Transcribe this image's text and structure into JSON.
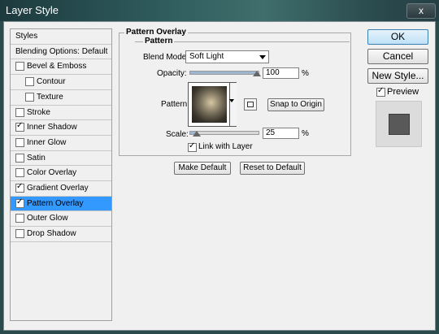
{
  "window": {
    "title": "Layer Style",
    "close_glyph": "x"
  },
  "styles_list": [
    {
      "label": "Styles",
      "checkbox": false,
      "checked": false,
      "indent": 0,
      "selected": false
    },
    {
      "label": "Blending Options: Default",
      "checkbox": false,
      "checked": false,
      "indent": 0,
      "selected": false
    },
    {
      "label": "Bevel & Emboss",
      "checkbox": true,
      "checked": false,
      "indent": 0,
      "selected": false
    },
    {
      "label": "Contour",
      "checkbox": true,
      "checked": false,
      "indent": 1,
      "selected": false
    },
    {
      "label": "Texture",
      "checkbox": true,
      "checked": false,
      "indent": 1,
      "selected": false
    },
    {
      "label": "Stroke",
      "checkbox": true,
      "checked": false,
      "indent": 0,
      "selected": false
    },
    {
      "label": "Inner Shadow",
      "checkbox": true,
      "checked": true,
      "indent": 0,
      "selected": false
    },
    {
      "label": "Inner Glow",
      "checkbox": true,
      "checked": false,
      "indent": 0,
      "selected": false
    },
    {
      "label": "Satin",
      "checkbox": true,
      "checked": false,
      "indent": 0,
      "selected": false
    },
    {
      "label": "Color Overlay",
      "checkbox": true,
      "checked": false,
      "indent": 0,
      "selected": false
    },
    {
      "label": "Gradient Overlay",
      "checkbox": true,
      "checked": true,
      "indent": 0,
      "selected": false
    },
    {
      "label": "Pattern Overlay",
      "checkbox": true,
      "checked": true,
      "indent": 0,
      "selected": true
    },
    {
      "label": "Outer Glow",
      "checkbox": true,
      "checked": false,
      "indent": 0,
      "selected": false
    },
    {
      "label": "Drop Shadow",
      "checkbox": true,
      "checked": false,
      "indent": 0,
      "selected": false
    }
  ],
  "panel": {
    "outer_title": "Pattern Overlay",
    "inner_title": "Pattern",
    "blend_mode": {
      "label": "Blend Mode:",
      "value": "Soft Light"
    },
    "opacity": {
      "label": "Opacity:",
      "value": "100",
      "unit": "%",
      "level": 1.0
    },
    "pattern": {
      "label": "Pattern:",
      "snap_button": "Snap to Origin"
    },
    "scale": {
      "label": "Scale:",
      "value": "25",
      "unit": "%",
      "level": 0.25
    },
    "link_with_layer": {
      "label": "Link with Layer",
      "checked": true
    },
    "make_default": "Make Default",
    "reset_default": "Reset to Default"
  },
  "actions": {
    "ok": "OK",
    "cancel": "Cancel",
    "new_style": "New Style...",
    "preview_label": "Preview",
    "preview_checked": true
  }
}
